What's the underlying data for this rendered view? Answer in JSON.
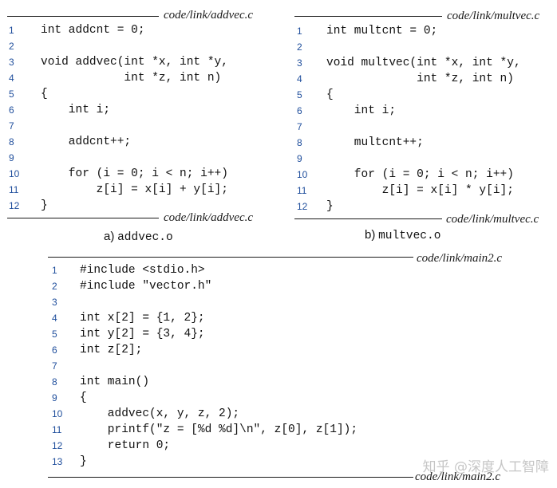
{
  "panels": {
    "addvec": {
      "path_top": "code/link/addvec.c",
      "path_bottom": "code/link/addvec.c",
      "caption_prefix": "a)",
      "caption_file": "addvec.o",
      "lines": [
        {
          "num": "1",
          "text": "int addcnt = 0;"
        },
        {
          "num": "2",
          "text": ""
        },
        {
          "num": "3",
          "text": "void addvec(int *x, int *y,"
        },
        {
          "num": "4",
          "text": "            int *z, int n)"
        },
        {
          "num": "5",
          "text": "{"
        },
        {
          "num": "6",
          "text": "    int i;"
        },
        {
          "num": "7",
          "text": ""
        },
        {
          "num": "8",
          "text": "    addcnt++;"
        },
        {
          "num": "9",
          "text": ""
        },
        {
          "num": "10",
          "text": "    for (i = 0; i < n; i++)"
        },
        {
          "num": "11",
          "text": "        z[i] = x[i] + y[i];"
        },
        {
          "num": "12",
          "text": "}"
        }
      ]
    },
    "multvec": {
      "path_top": "code/link/multvec.c",
      "path_bottom": "code/link/multvec.c",
      "caption_prefix": "b)",
      "caption_file": "multvec.o",
      "lines": [
        {
          "num": "1",
          "text": "int multcnt = 0;"
        },
        {
          "num": "2",
          "text": ""
        },
        {
          "num": "3",
          "text": "void multvec(int *x, int *y,"
        },
        {
          "num": "4",
          "text": "             int *z, int n)"
        },
        {
          "num": "5",
          "text": "{"
        },
        {
          "num": "6",
          "text": "    int i;"
        },
        {
          "num": "7",
          "text": ""
        },
        {
          "num": "8",
          "text": "    multcnt++;"
        },
        {
          "num": "9",
          "text": ""
        },
        {
          "num": "10",
          "text": "    for (i = 0; i < n; i++)"
        },
        {
          "num": "11",
          "text": "        z[i] = x[i] * y[i];"
        },
        {
          "num": "12",
          "text": "}"
        }
      ]
    },
    "main2": {
      "path_top": "code/link/main2.c",
      "path_bottom": "code/link/main2.c",
      "lines": [
        {
          "num": "1",
          "text": "#include <stdio.h>"
        },
        {
          "num": "2",
          "text": "#include \"vector.h\""
        },
        {
          "num": "3",
          "text": ""
        },
        {
          "num": "4",
          "text": "int x[2] = {1, 2};"
        },
        {
          "num": "5",
          "text": "int y[2] = {3, 4};"
        },
        {
          "num": "6",
          "text": "int z[2];"
        },
        {
          "num": "7",
          "text": ""
        },
        {
          "num": "8",
          "text": "int main()"
        },
        {
          "num": "9",
          "text": "{"
        },
        {
          "num": "10",
          "text": "    addvec(x, y, z, 2);"
        },
        {
          "num": "11",
          "text": "    printf(\"z = [%d %d]\\n\", z[0], z[1]);"
        },
        {
          "num": "12",
          "text": "    return 0;"
        },
        {
          "num": "13",
          "text": "}"
        }
      ]
    }
  },
  "watermark": "知乎 @深度人工智障"
}
